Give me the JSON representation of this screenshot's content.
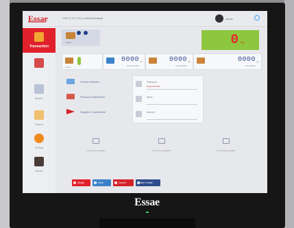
{
  "brand": {
    "logo_text": "Essae",
    "monitor_text": "Essae",
    "accent": "#d2232a"
  },
  "header": {
    "title": "CWT 9.9.9 TnS | Gold Rethvlanla",
    "user_name": "admin",
    "icons": [
      "user-avatar-icon",
      "power-icon"
    ]
  },
  "sidebar": {
    "items": [
      {
        "label": "Transaction",
        "icon": "truck-icon",
        "active": true
      },
      {
        "label": "",
        "icon": "weighbridge-icon"
      },
      {
        "label": "Master",
        "icon": "database-icon"
      },
      {
        "label": "Report",
        "icon": "report-icon"
      },
      {
        "label": "Setting",
        "icon": "gear-icon"
      },
      {
        "label": "Admin",
        "icon": "admin-user-icon"
      }
    ]
  },
  "scale": {
    "label": "Scale"
  },
  "weight": {
    "value": "0",
    "unit": "Kg",
    "color": "#8dc63f"
  },
  "readings": [
    {
      "label": "Empty",
      "value": "",
      "icon": "truck-icon"
    },
    {
      "label": "Gross Weight",
      "value": "0000",
      "unit": "Kg",
      "icon": "gross-weight-icon"
    },
    {
      "label": "Load Weight",
      "value": "0000",
      "unit": "Kg",
      "icon": "load-weight-icon"
    },
    {
      "label": "Net Weight",
      "value": "0000",
      "unit": "Kg",
      "icon": "net-weight-icon"
    }
  ],
  "lists": [
    {
      "label": "Vehicle Number",
      "icon": "vehicle-icon"
    },
    {
      "label": "Product Code/Name",
      "icon": "product-icon"
    },
    {
      "label": "Supplier Code/Name",
      "icon": "supplier-icon"
    }
  ],
  "form": {
    "fields": [
      {
        "value": "Transport",
        "sub": "Required Field"
      },
      {
        "value": "Items",
        "sub": ""
      },
      {
        "value": "Amount",
        "sub": ""
      }
    ]
  },
  "cameras": [
    {
      "label": "No camera available"
    },
    {
      "label": "No camera available"
    },
    {
      "label": "No camera available"
    }
  ],
  "buttons": [
    {
      "label": "Weigh",
      "color": "#e0212b"
    },
    {
      "label": "Save",
      "color": "#3a83c9"
    },
    {
      "label": "Cancel",
      "color": "#d2232a"
    },
    {
      "label": "Ticket Create",
      "color": "#2f4c8c"
    }
  ]
}
